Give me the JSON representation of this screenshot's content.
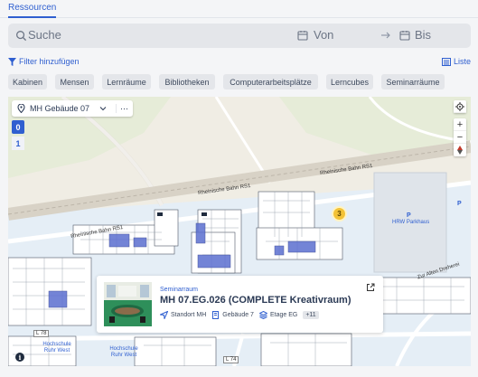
{
  "tabs": [
    {
      "label": "Ressourcen",
      "active": true
    }
  ],
  "search": {
    "placeholder": "Suche",
    "from_placeholder": "Von",
    "to_placeholder": "Bis"
  },
  "filter": {
    "add_label": "Filter hinzufügen",
    "list_label": "Liste"
  },
  "categories": [
    "Kabinen",
    "Mensen",
    "Lernräume",
    "Bibliotheken",
    "Computerarbeitsplätze",
    "Lerncubes",
    "Seminarräume"
  ],
  "map": {
    "building_select": "MH Gebäude 07",
    "floors": [
      "0",
      "1"
    ],
    "active_floor": "0",
    "cluster_count": "3",
    "labels": {
      "rail_1": "Rheinische Bahn RS1",
      "rail_2": "Rheinische Bahn RS1",
      "rail_3": "Rheinische Bahn RS1",
      "road": "Zur Alten Dreherei",
      "parking_symbol": "P",
      "parking": "HRW Parkhaus",
      "p_right": "P",
      "l78": "L 78",
      "l74": "L 74",
      "station_1": "Hochschule Ruhr West",
      "station_2": "Hochschule Ruhr West"
    },
    "controls": {
      "locate": "locate",
      "zoom_in": "+",
      "zoom_out": "−",
      "reset_north": "compass"
    }
  },
  "card": {
    "type": "Seminarraum",
    "title": "MH 07.EG.026 (COMPLETE Kreativraum)",
    "location": "Standort MH",
    "building": "Gebäude 7",
    "floor": "Etage EG",
    "more": "+11"
  },
  "colors": {
    "accent": "#2f5fd0",
    "cluster": "#f3c236",
    "map_bg": "#f0ede4",
    "campus": "#e5eef6"
  }
}
